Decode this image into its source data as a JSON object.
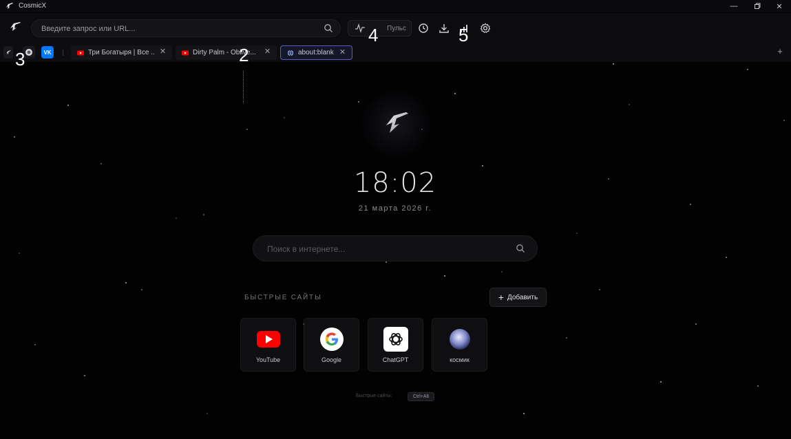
{
  "window": {
    "title": "CosmicX",
    "controls": [
      "minimize",
      "maximize",
      "close"
    ]
  },
  "toolbar": {
    "url_placeholder": "Введите запрос или URL...",
    "pulse_label": "Пульс",
    "icons": [
      "history-icon",
      "download-icon",
      "signal-icon",
      "settings-icon"
    ]
  },
  "tabs": {
    "pinned": [
      {
        "icon": "cosmicx-icon"
      },
      {
        "icon": "globe-icon"
      },
      {
        "icon": "vk-icon"
      }
    ],
    "open": [
      {
        "title": "Три Богатыря | Все ...",
        "favicon": "youtube-icon"
      },
      {
        "title": "Dirty Palm - Oblive...",
        "favicon": "youtube-icon"
      },
      {
        "title": "about:blank",
        "favicon": "globe-icon",
        "active": true
      }
    ]
  },
  "annotations": [
    "1",
    "2",
    "3",
    "4",
    "5"
  ],
  "main": {
    "time": "18:02",
    "date": "21 марта 2026 г.",
    "search_placeholder": "Поиск в интернете...",
    "quick_sites_heading": "БЫСТРЫЕ САЙТЫ",
    "add_label": "Добавить",
    "quick_sites": [
      {
        "label": "YouTube",
        "icon": "youtube-icon"
      },
      {
        "label": "Google",
        "icon": "google-icon"
      },
      {
        "label": "ChatGPT",
        "icon": "chatgpt-icon"
      },
      {
        "label": "космик",
        "icon": "planet-icon"
      }
    ],
    "shortcut_hint": "Быстрые сайты:",
    "shortcut_key": "Ctrl+Alt"
  },
  "colors": {
    "background": "#020203",
    "active_tab_border": "#5a59c8",
    "youtube_red": "#ff0000"
  }
}
